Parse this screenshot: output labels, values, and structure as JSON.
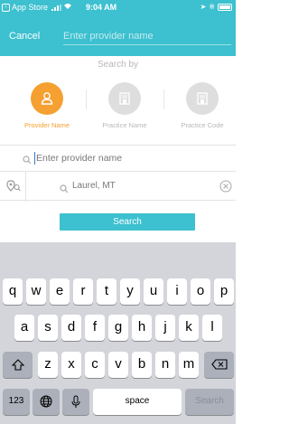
{
  "status": {
    "carrier": "App Store",
    "time": "9:04 AM"
  },
  "nav": {
    "cancel": "Cancel",
    "placeholder": "Enter provider name"
  },
  "search_by": {
    "title": "Search by",
    "options": [
      {
        "label": "Provider Name",
        "icon": "person-icon",
        "selected": true
      },
      {
        "label": "Practice Name",
        "icon": "building-icon",
        "selected": false
      },
      {
        "label": "Practice Code",
        "icon": "building-icon",
        "selected": false
      }
    ]
  },
  "provider_field": {
    "placeholder": "Enter provider name"
  },
  "location_field": {
    "value": "Laurel, MT"
  },
  "search_button": "Search",
  "keyboard": {
    "row1": [
      "q",
      "w",
      "e",
      "r",
      "t",
      "y",
      "u",
      "i",
      "o",
      "p"
    ],
    "row2": [
      "a",
      "s",
      "d",
      "f",
      "g",
      "h",
      "j",
      "k",
      "l"
    ],
    "row3": [
      "z",
      "x",
      "c",
      "v",
      "b",
      "n",
      "m"
    ],
    "numbers": "123",
    "space": "space",
    "action": "Search"
  },
  "colors": {
    "accent": "#3dc0cf",
    "selected": "#f5a030",
    "keyboard_bg": "#d3d5da"
  }
}
